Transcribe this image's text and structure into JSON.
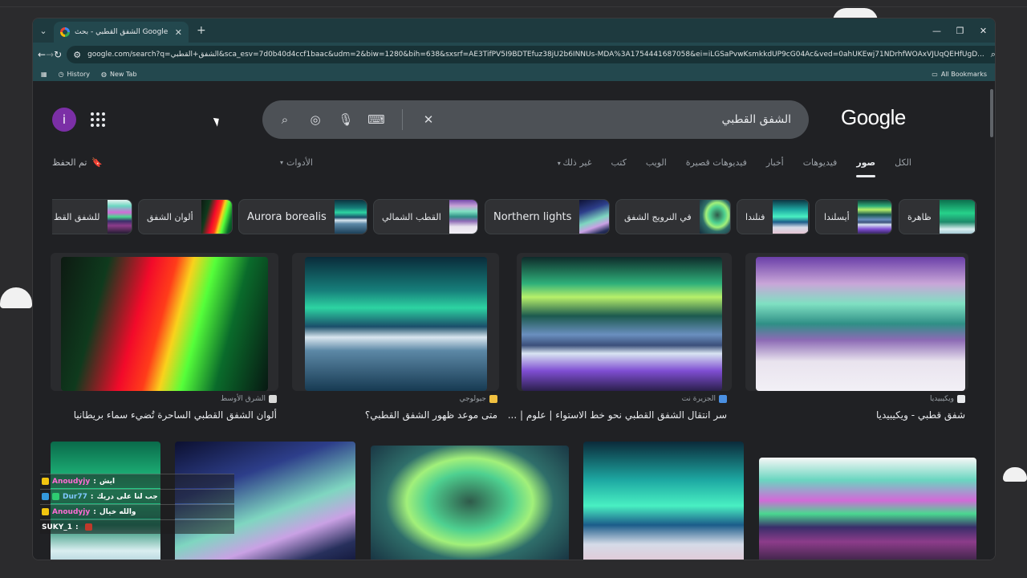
{
  "browser": {
    "tab_title": "الشفق القطبي - بحث Google",
    "tab_close": "✕",
    "new_tab": "+",
    "url": "google.com/search?q=الشفق+القطبي&sca_esv=7d0b40d4ccf1baac&udm=2&biw=1280&bih=638&sxsrf=AE3TifPV5I9BDTEfuz38jU2b6INNUs-MDA%3A1754441687058&ei=iLGSaPvwKsmkkdUP9cG04Ac&ved=0ahUKEwj71NDrhfWOAxVJUqQEHfUgD...",
    "profile_initial": "i",
    "bookmarks": [
      {
        "label": "History"
      },
      {
        "label": "New Tab"
      }
    ],
    "all_bookmarks": "All Bookmarks"
  },
  "page": {
    "avatar_initial": "i",
    "search_query": "الشفق القطبي",
    "logo": "Google",
    "saved_label": "تم الحفظ",
    "tools_label": "الأدوات",
    "tabs": [
      {
        "label": "الكل"
      },
      {
        "label": "صور"
      },
      {
        "label": "فيديوهات"
      },
      {
        "label": "أخبار"
      },
      {
        "label": "فيديوهات قصيرة"
      },
      {
        "label": "الويب"
      },
      {
        "label": "كتب"
      },
      {
        "label": "غير ذلك"
      }
    ],
    "chips": [
      {
        "label": "ظاهرة"
      },
      {
        "label": "أيسلندا"
      },
      {
        "label": "فنلندا"
      },
      {
        "label": "في النرويج الشفق"
      },
      {
        "label": "Northern lights"
      },
      {
        "label": "القطب الشمالي"
      },
      {
        "label": "Aurora borealis"
      },
      {
        "label": "ألوان الشفق"
      },
      {
        "label": "للشفق القط"
      }
    ],
    "results": [
      {
        "source": "ويكيبيديا",
        "caption": "شفق قطبي - ويكيبيديا"
      },
      {
        "source": "الجزيرة نت",
        "caption": "سر انتقال الشفق القطبي نحو خط الاستواء | علوم | ..."
      },
      {
        "source": "جيولوجي",
        "caption": "متى موعد ظهور الشفق القطبي؟"
      },
      {
        "source": "الشرق الأوسط",
        "caption": "ألوان الشفق القطبي الساحرة تُضيء سماء بريطانيا"
      }
    ]
  },
  "chat": [
    {
      "user": "Anoudyjy",
      "msg": "ايش"
    },
    {
      "user": "Dur77",
      "msg": "جب لنا على دريك"
    },
    {
      "user": "Anoudyjy",
      "msg": "والله خيال"
    },
    {
      "user": "SUKY_1",
      "msg": ""
    }
  ],
  "colors": {
    "tabstrip": "#1e3a3f",
    "toolbar": "#23484e",
    "page_bg": "#202124",
    "searchbar": "#4d5156",
    "avatar": "#7b2fa6"
  }
}
